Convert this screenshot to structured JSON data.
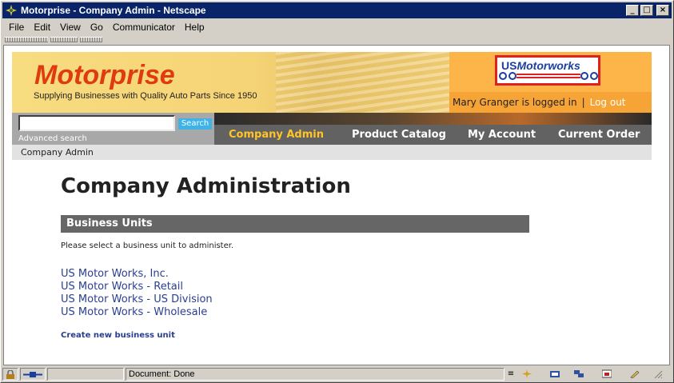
{
  "window": {
    "title": "Motorprise - Company Admin - Netscape",
    "minimize_label": "_",
    "maximize_label": "□",
    "close_label": "×"
  },
  "menu": {
    "items": [
      {
        "label": "File"
      },
      {
        "label": "Edit"
      },
      {
        "label": "View"
      },
      {
        "label": "Go"
      },
      {
        "label": "Communicator"
      },
      {
        "label": "Help"
      }
    ]
  },
  "header": {
    "brand_name": "Motorprise",
    "tagline": "Supplying Businesses with Quality Auto Parts Since 1950",
    "partner_logo_us": "US",
    "partner_logo_name": "Motorworks",
    "logged_in_text": "Mary Granger is logged in",
    "separator": "|",
    "logout_label": "Log out"
  },
  "search": {
    "input_value": "",
    "button_label": "Search",
    "advanced_label": "Advanced search"
  },
  "nav": {
    "items": [
      {
        "label": "Company Admin",
        "active": true
      },
      {
        "label": "Product Catalog",
        "active": false
      },
      {
        "label": "My Account",
        "active": false
      },
      {
        "label": "Current Order",
        "active": false
      }
    ]
  },
  "breadcrumb": {
    "text": "Company Admin"
  },
  "main": {
    "title": "Company Administration",
    "section_title": "Business Units",
    "instruction": "Please select a business unit to administer.",
    "business_units": [
      "US Motor Works, Inc.",
      "US Motor Works - Retail",
      "US Motor Works - US Division",
      "US Motor Works - Wholesale"
    ],
    "create_link": "Create new business unit"
  },
  "statusbar": {
    "document_status": "Document: Done"
  },
  "colors": {
    "brand_red": "#e03a10",
    "nav_active": "#ffc425",
    "link_blue": "#2a3e8f",
    "partner_orange": "#fdb54a",
    "title_bar": "#0a246a"
  }
}
